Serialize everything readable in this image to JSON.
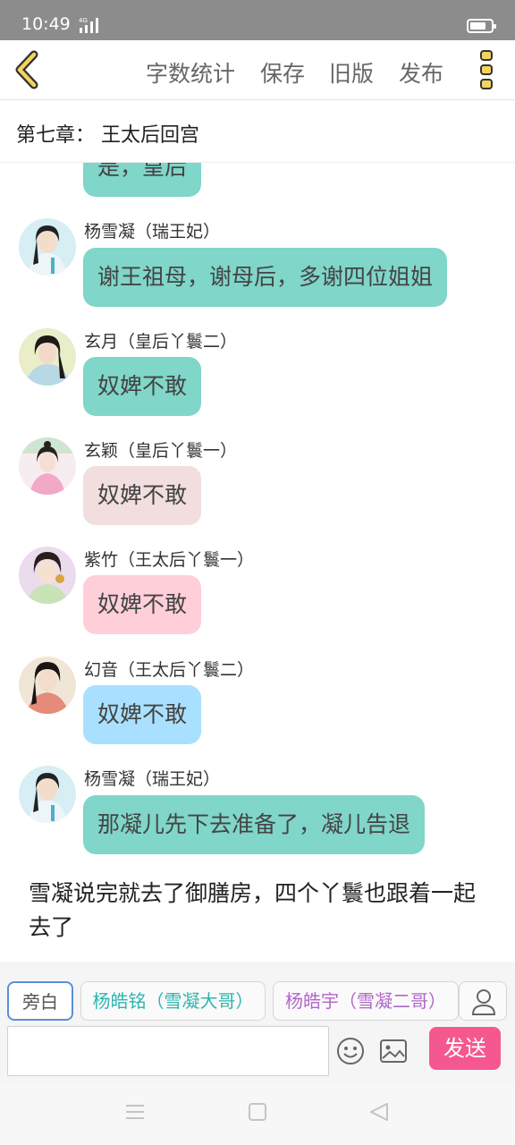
{
  "status_bar": {
    "time": "10:49",
    "network": "4G"
  },
  "toolbar": {
    "items": [
      {
        "label": "字数统计"
      },
      {
        "label": "保存"
      },
      {
        "label": "旧版"
      },
      {
        "label": "发布"
      }
    ]
  },
  "chapter": {
    "title": "第七章：  王太后回宫"
  },
  "messages": [
    {
      "speaker": "",
      "text": "是，皇后",
      "bubble_color": "#7fd6c9"
    },
    {
      "speaker": "杨雪凝（瑞王妃）",
      "text": "谢王祖母，谢母后，多谢四位姐姐",
      "bubble_color": "#7fd6c9"
    },
    {
      "speaker": "玄月（皇后丫鬟二）",
      "text": "奴婢不敢",
      "bubble_color": "#7fd6c9"
    },
    {
      "speaker": "玄颖（皇后丫鬟一）",
      "text": "奴婢不敢",
      "bubble_color": "#f2dede"
    },
    {
      "speaker": "紫竹（王太后丫鬟一）",
      "text": "奴婢不敢",
      "bubble_color": "#ffcfd9"
    },
    {
      "speaker": "幻音（王太后丫鬟二）",
      "text": "奴婢不敢",
      "bubble_color": "#a9e0ff"
    },
    {
      "speaker": "杨雪凝（瑞王妃）",
      "text": "那凝儿先下去准备了，凝儿告退",
      "bubble_color": "#7fd6c9"
    }
  ],
  "narration": "雪凝说完就去了御膳房，四个丫鬟也跟着一起去了",
  "characters": [
    {
      "label": "旁白"
    },
    {
      "label": "杨皓铭（雪凝大哥）"
    },
    {
      "label": "杨皓宇（雪凝二哥）"
    }
  ],
  "composer": {
    "placeholder": "",
    "send_label": "发送"
  }
}
